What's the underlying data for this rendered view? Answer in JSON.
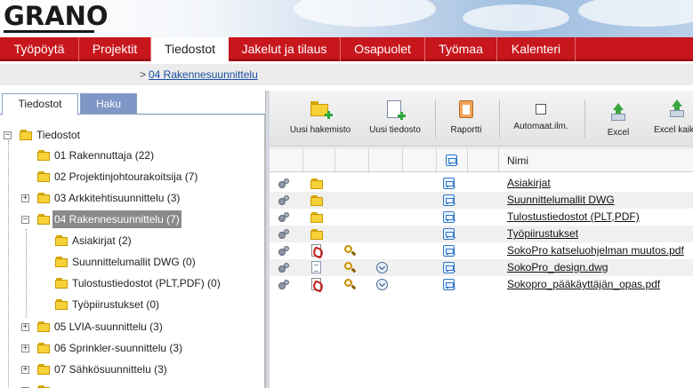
{
  "logo": {
    "text": "GRANO"
  },
  "nav": {
    "tabs": [
      {
        "label": "Työpöytä",
        "active": false
      },
      {
        "label": "Projektit",
        "active": false
      },
      {
        "label": "Tiedostot",
        "active": true
      },
      {
        "label": "Jakelut ja tilaus",
        "active": false
      },
      {
        "label": "Osapuolet",
        "active": false
      },
      {
        "label": "Työmaa",
        "active": false
      },
      {
        "label": "Kalenteri",
        "active": false
      }
    ]
  },
  "breadcrumb": {
    "separator": ">",
    "current": "04 Rakennesuunnittelu"
  },
  "left_tabs": [
    {
      "label": "Tiedostot",
      "active": true
    },
    {
      "label": "Haku",
      "active": false
    }
  ],
  "tree": {
    "root": "Tiedostot",
    "items": [
      {
        "label": "01 Rakennuttaja (22)"
      },
      {
        "label": "02 Projektinjohtourakoitsija (7)"
      },
      {
        "label": "03 Arkkitehtisuunnittelu (3)"
      },
      {
        "label": "04 Rakennesuunnittelu (7)"
      },
      {
        "label": "Asiakirjat (2)"
      },
      {
        "label": "Suunnittelumallit DWG (0)"
      },
      {
        "label": "Tulostustiedostot (PLT,PDF) (0)"
      },
      {
        "label": "Työpiirustukset (0)"
      },
      {
        "label": "05 LVIA-suunnittelu (3)"
      },
      {
        "label": "06 Sprinkler-suunnittelu (3)"
      },
      {
        "label": "07 Sähkösuunnittelu (3)"
      }
    ]
  },
  "toolbar": {
    "new_folder": "Uusi hakemisto",
    "new_file": "Uusi tiedosto",
    "report": "Raportti",
    "auto_notify": "Automaat.ilm.",
    "excel": "Excel",
    "excel_all": "Excel kaik"
  },
  "grid": {
    "name_header": "Nimi",
    "rows": [
      {
        "name": "Asiakirjat",
        "type": "folder"
      },
      {
        "name": "Suunnittelumallit DWG",
        "type": "folder"
      },
      {
        "name": "Tulostustiedostot (PLT,PDF)",
        "type": "folder"
      },
      {
        "name": "Työpiirustukset",
        "type": "folder"
      },
      {
        "name": "SokoPro katseluohjelman muutos.pdf",
        "type": "pdf"
      },
      {
        "name": "SokoPro_design.dwg",
        "type": "dwg"
      },
      {
        "name": "Sokopro_pääkäyttäjän_opas.pdf",
        "type": "pdf"
      }
    ]
  },
  "colors": {
    "nav_red": "#c8161d",
    "link_blue": "#1a4fa0",
    "folder_yellow": "#f6d238",
    "tab_blue": "#7e97c6"
  }
}
